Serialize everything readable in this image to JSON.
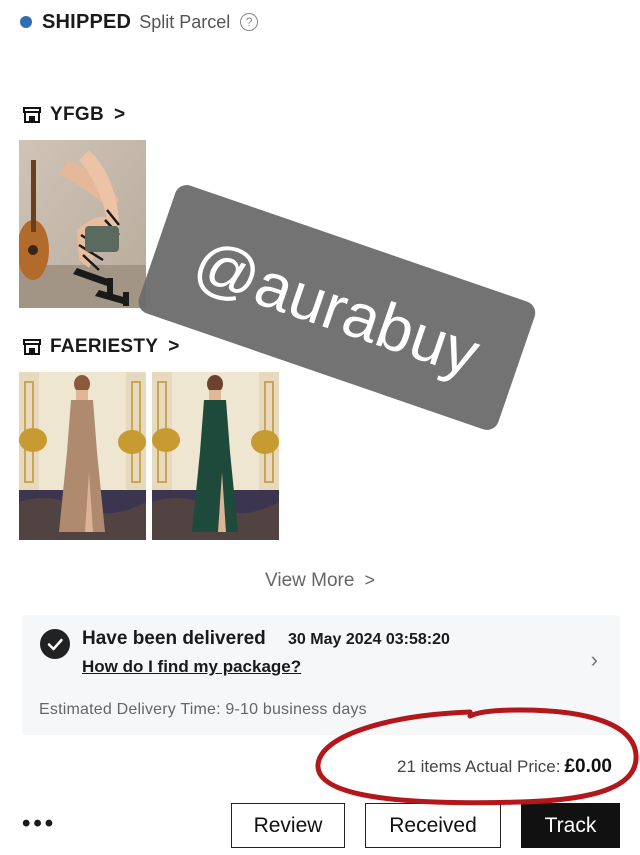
{
  "status": {
    "label": "SHIPPED",
    "sub": "Split Parcel",
    "help_icon": "?"
  },
  "stores": [
    {
      "name": "YFGB",
      "chevron": ">"
    },
    {
      "name": "FAERIESTY",
      "chevron": ">"
    }
  ],
  "view_more": {
    "label": "View More",
    "chevron": ">"
  },
  "delivery": {
    "title": "Have been delivered",
    "date": "30 May 2024 03:58:20",
    "link": "How do I find my package?",
    "estimated": "Estimated Delivery Time: 9-10 business days",
    "chevron": "›"
  },
  "summary": {
    "label": "21 items Actual Price:",
    "price": "£0.00"
  },
  "actions": {
    "more": "•••",
    "review": "Review",
    "received": "Received",
    "track": "Track"
  },
  "watermark": {
    "text": "@aurabuy"
  },
  "colors": {
    "status_dot": "#2f6db3",
    "primary_button": "#111111",
    "annotation_circle": "#b3161b",
    "watermark_bg": "#6b6b6b"
  }
}
